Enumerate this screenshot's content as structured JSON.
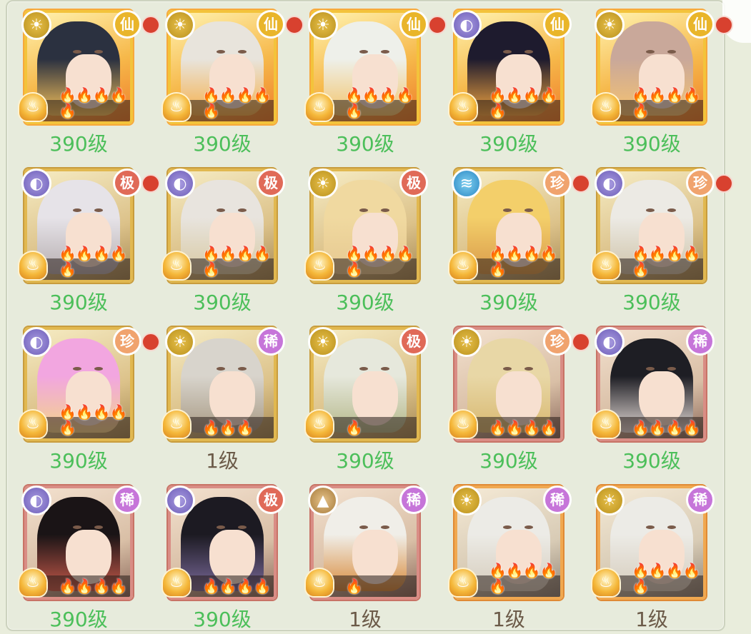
{
  "grid": {
    "rows": [
      [
        {
          "type": "sun",
          "type_icon": "sun-icon",
          "rarity": "仙",
          "rarity_class": "xian",
          "dot": true,
          "frame": "xian",
          "flames": "🔥🔥🔥🔥🔥",
          "flame_color": "orange",
          "level": "390级",
          "hair": "#2b3140",
          "bg": "#f8c25a"
        },
        {
          "type": "sun",
          "type_icon": "sun-icon",
          "rarity": "仙",
          "rarity_class": "xian",
          "dot": true,
          "frame": "xian",
          "flames": "🔥🔥🔥🔥🔥",
          "flame_color": "orange",
          "level": "390级",
          "hair": "#e8e4dc",
          "bg": "#f6b04a"
        },
        {
          "type": "sun",
          "type_icon": "sun-icon",
          "rarity": "仙",
          "rarity_class": "xian",
          "dot": true,
          "frame": "xian",
          "flames": "🔥🔥🔥🔥🔥",
          "flame_color": "orange",
          "level": "390级",
          "hair": "#eef0ea",
          "bg": "#f3c46a"
        },
        {
          "type": "moon",
          "type_icon": "moon-icon",
          "rarity": "仙",
          "rarity_class": "xian",
          "dot": false,
          "frame": "xian",
          "flames": "🔥🔥🔥🔥🔥",
          "flame_color": "orange",
          "level": "390级",
          "hair": "#1e1b2e",
          "bg": "#f5a640"
        },
        {
          "type": "sun",
          "type_icon": "sun-icon",
          "rarity": "仙",
          "rarity_class": "xian",
          "dot": true,
          "frame": "xian",
          "flames": "🔥🔥🔥🔥🔥",
          "flame_color": "orange",
          "level": "390级",
          "hair": "#c9a89a",
          "bg": "#f6c370"
        }
      ],
      [
        {
          "type": "moon",
          "type_icon": "moon-icon",
          "rarity": "极",
          "rarity_class": "ji",
          "dot": true,
          "frame": "gold",
          "flames": "🔥🔥🔥🔥🔥",
          "flame_color": "orange",
          "level": "390级",
          "hair": "#e6e3e8",
          "bg": "#b6aeb0"
        },
        {
          "type": "moon",
          "type_icon": "moon-icon",
          "rarity": "极",
          "rarity_class": "ji",
          "dot": false,
          "frame": "gold",
          "flames": "🔥🔥🔥🔥🔥",
          "flame_color": "orange",
          "level": "390级",
          "hair": "#e8e4de",
          "bg": "#d8c9a2"
        },
        {
          "type": "sun",
          "type_icon": "sun-icon",
          "rarity": "极",
          "rarity_class": "ji",
          "dot": false,
          "frame": "gold",
          "flames": "🔥🔥🔥🔥🔥",
          "flame_color": "orange",
          "level": "390级",
          "hair": "#f0d9a0",
          "bg": "#e6c890"
        },
        {
          "type": "wave",
          "type_icon": "wave-icon",
          "rarity": "珍",
          "rarity_class": "zhen",
          "dot": true,
          "frame": "gold",
          "flames": "🔥🔥🔥🔥🔥",
          "flame_color": "orange",
          "level": "390级",
          "hair": "#f3cf6a",
          "bg": "#d99a4a"
        },
        {
          "type": "moon",
          "type_icon": "moon-icon",
          "rarity": "珍",
          "rarity_class": "zhen",
          "dot": true,
          "frame": "gold",
          "flames": "🔥🔥🔥🔥🔥",
          "flame_color": "orange",
          "level": "390级",
          "hair": "#eceae4",
          "bg": "#cfc3a8"
        }
      ],
      [
        {
          "type": "moon",
          "type_icon": "moon-icon",
          "rarity": "珍",
          "rarity_class": "zhen",
          "dot": true,
          "frame": "gold",
          "flames": "🔥🔥🔥🔥🔥",
          "flame_color": "orange",
          "level": "390级",
          "hair": "#f2a6e0",
          "bg": "#f3d48a"
        },
        {
          "type": "sun",
          "type_icon": "sun-icon",
          "rarity": "稀",
          "rarity_class": "xi",
          "dot": false,
          "frame": "gold",
          "flames": "🔥🔥🔥",
          "flame_color": "orange",
          "level": "1级",
          "plain": true,
          "hair": "#d8d4cc",
          "bg": "#a89a84"
        },
        {
          "type": "sun",
          "type_icon": "sun-icon",
          "rarity": "极",
          "rarity_class": "ji",
          "dot": false,
          "frame": "gold",
          "flames": "🔥",
          "flame_color": "orange",
          "level": "390级",
          "hair": "#e6e8dc",
          "bg": "#b5b88a"
        },
        {
          "type": "sun",
          "type_icon": "sun-icon",
          "rarity": "珍",
          "rarity_class": "zhen",
          "dot": true,
          "frame": "red",
          "flames": "🔥🔥🔥🔥",
          "flame_color": "purple",
          "level": "390级",
          "hair": "#e8d7a6",
          "bg": "#d8b870"
        },
        {
          "type": "moon",
          "type_icon": "moon-icon",
          "rarity": "稀",
          "rarity_class": "xi",
          "dot": false,
          "frame": "red",
          "flames": "🔥🔥🔥🔥",
          "flame_color": "purple",
          "level": "390级",
          "hair": "#1e1e24",
          "bg": "#e6dcd8"
        }
      ],
      [
        {
          "type": "moon",
          "type_icon": "moon-icon",
          "rarity": "稀",
          "rarity_class": "xi",
          "dot": false,
          "frame": "red",
          "flames": "🔥🔥🔥🔥",
          "flame_color": "purple",
          "level": "390级",
          "hair": "#1a1416",
          "bg": "#c85a4a"
        },
        {
          "type": "moon",
          "type_icon": "moon-icon",
          "rarity": "极",
          "rarity_class": "ji",
          "dot": false,
          "frame": "red",
          "flames": "🔥🔥🔥🔥",
          "flame_color": "purple",
          "level": "390级",
          "hair": "#1c1a22",
          "bg": "#7a6a9a"
        },
        {
          "type": "mount",
          "type_icon": "mountain-icon",
          "rarity": "稀",
          "rarity_class": "xi",
          "dot": false,
          "frame": "red",
          "flames": "🔥",
          "flame_color": "purple",
          "level": "1级",
          "plain": true,
          "hair": "#f0eee8",
          "bg": "#d88a3a"
        },
        {
          "type": "sun",
          "type_icon": "sun-icon",
          "rarity": "稀",
          "rarity_class": "xi",
          "dot": false,
          "frame": "orange",
          "flames": "🔥🔥🔥🔥🔥",
          "flame_color": "blue",
          "level": "1级",
          "plain": true,
          "hair": "#ecebe6",
          "bg": "#d6ccbc"
        },
        {
          "type": "sun",
          "type_icon": "sun-icon",
          "rarity": "稀",
          "rarity_class": "xi",
          "dot": false,
          "frame": "orange",
          "flames": "🔥🔥🔥🔥🔥",
          "flame_color": "blue",
          "level": "1级",
          "plain": true,
          "hair": "#ecebe6",
          "bg": "#d6ccbc"
        }
      ]
    ]
  },
  "type_glyphs": {
    "sun": "☀",
    "moon": "◐",
    "wave": "≋",
    "mount": "▲"
  },
  "emblem_glyph": "♨"
}
